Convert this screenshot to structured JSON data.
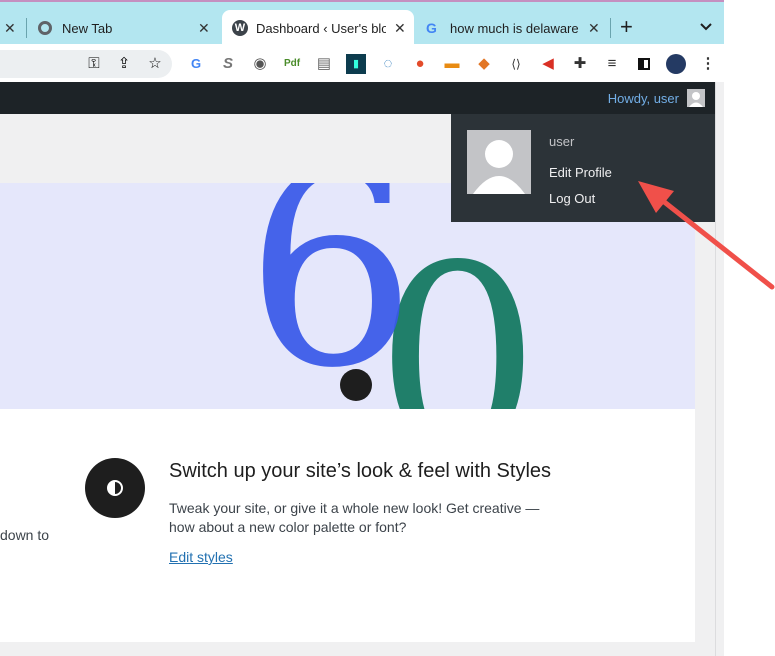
{
  "browser": {
    "tabs": [
      {
        "title": "",
        "favicon": "close-icon"
      },
      {
        "title": "New Tab",
        "favicon": "chrome-icon"
      },
      {
        "title": "Dashboard ‹ User's blo",
        "favicon": "wordpress-icon",
        "active": true
      },
      {
        "title": "how much is delaware",
        "favicon": "google-icon"
      }
    ],
    "new_tab_symbol": "+",
    "tab_menu_symbol": "⌄",
    "extensions": [
      "key-icon",
      "share-icon",
      "star-icon",
      "translate-icon",
      "s-icon",
      "scanner-icon",
      "pdf-icon",
      "note-icon",
      "game-icon",
      "chat-icon",
      "s-badge-icon",
      "message-icon",
      "metamask-icon",
      "code-icon",
      "megaphone-icon",
      "puzzle-icon",
      "playlist-icon",
      "sidepanel-icon",
      "profile-avatar-icon",
      "more-icon"
    ]
  },
  "adminbar": {
    "howdy": "Howdy, user"
  },
  "dropdown": {
    "username": "user",
    "edit_profile": "Edit Profile",
    "log_out": "Log Out"
  },
  "banner": {
    "version_major": "6",
    "version_minor": "0"
  },
  "styles_section": {
    "title": "Switch up your site’s look & feel with Styles",
    "description": "Tweak your site, or give it a whole new look! Get creative — how about a new color palette or font?",
    "link": "Edit styles",
    "left_fragment": "down to"
  },
  "colors": {
    "adminbar": "#1d2327",
    "dropdown": "#2c3338",
    "link": "#2271b1",
    "arrow": "#f0504a",
    "six": "#3858e9",
    "zero": "#167a63"
  }
}
